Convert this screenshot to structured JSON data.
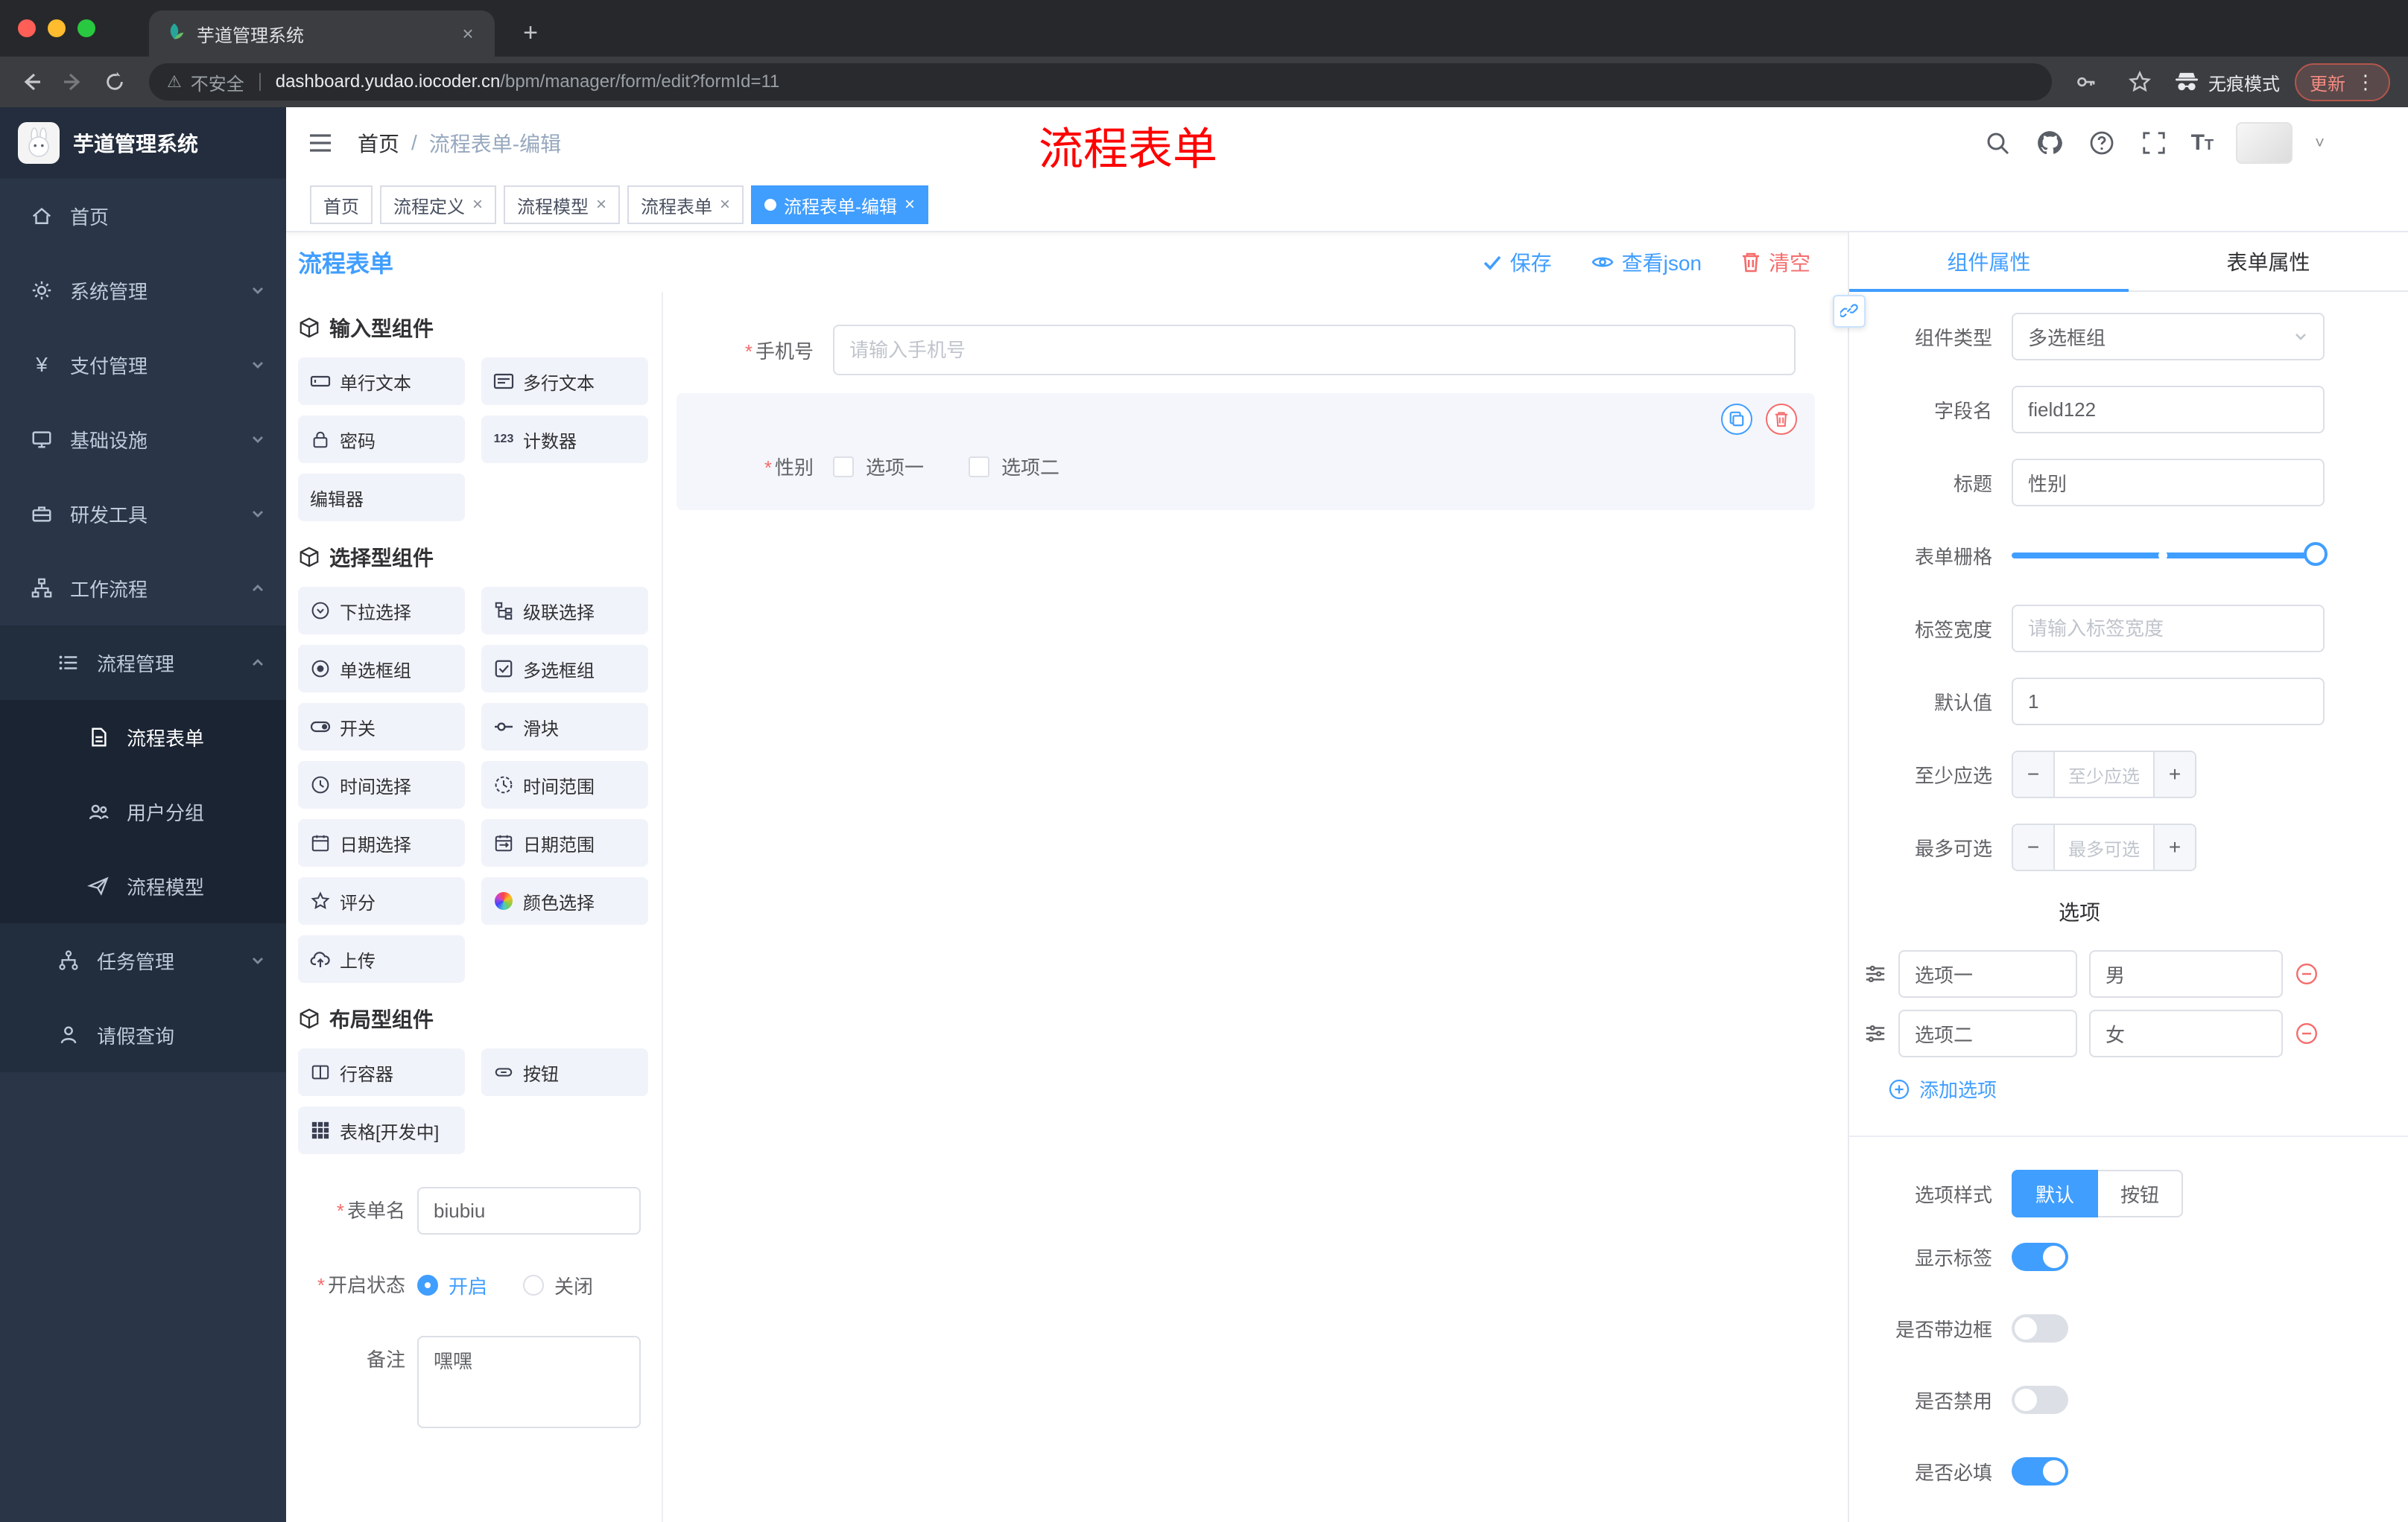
{
  "marks": {
    "required": "*",
    "close": "×",
    "plus": "+",
    "minus": "−",
    "kebab": "⋮",
    "warning": "⚠",
    "slash": "/",
    "caret": "˅",
    "dot123": "123",
    "font_big": "T",
    "font_small": "T",
    "yen": "¥"
  },
  "colors": {
    "primary": "#409eff",
    "danger": "#f56c6c",
    "annotation": "#fe0000",
    "sidebar_bg": "#2a3648"
  },
  "browser": {
    "tab_title": "芋道管理系统",
    "security_label": "不安全",
    "url_host": "dashboard.yudao.iocoder.cn",
    "url_path": "/bpm/manager/form/edit?formId=11",
    "incognito_label": "无痕模式",
    "update_label": "更新"
  },
  "sidebar": {
    "logo_title": "芋道管理系统",
    "home": "首页",
    "system": "系统管理",
    "payment": "支付管理",
    "infra": "基础设施",
    "devtools": "研发工具",
    "workflow": "工作流程",
    "process_mgmt": "流程管理",
    "process_form": "流程表单",
    "user_group": "用户分组",
    "process_model": "流程模型",
    "task_mgmt": "任务管理",
    "leave_query": "请假查询"
  },
  "header": {
    "breadcrumb_home": "首页",
    "breadcrumb_current": "流程表单-编辑",
    "annotation": "流程表单"
  },
  "tags": [
    {
      "label": "首页"
    },
    {
      "label": "流程定义"
    },
    {
      "label": "流程模型"
    },
    {
      "label": "流程表单"
    },
    {
      "label": "流程表单-编辑"
    }
  ],
  "designer": {
    "title": "流程表单",
    "save": "保存",
    "view_json": "查看json",
    "clear": "清空"
  },
  "palette": {
    "sections": [
      {
        "title": "输入型组件",
        "items": [
          {
            "label": "单行文本"
          },
          {
            "label": "多行文本"
          },
          {
            "label": "密码"
          },
          {
            "label": "计数器"
          },
          {
            "label": "编辑器"
          }
        ]
      },
      {
        "title": "选择型组件",
        "items": [
          {
            "label": "下拉选择"
          },
          {
            "label": "级联选择"
          },
          {
            "label": "单选框组"
          },
          {
            "label": "多选框组"
          },
          {
            "label": "开关"
          },
          {
            "label": "滑块"
          },
          {
            "label": "时间选择"
          },
          {
            "label": "时间范围"
          },
          {
            "label": "日期选择"
          },
          {
            "label": "日期范围"
          },
          {
            "label": "评分"
          },
          {
            "label": "颜色选择"
          },
          {
            "label": "上传"
          }
        ]
      },
      {
        "title": "布局型组件",
        "items": [
          {
            "label": "行容器"
          },
          {
            "label": "按钮"
          },
          {
            "label": "表格[开发中]"
          }
        ]
      }
    ]
  },
  "form_settings": {
    "name_label": "表单名",
    "name_value": "biubiu",
    "status_label": "开启状态",
    "status_on": "开启",
    "status_off": "关闭",
    "remark_label": "备注",
    "remark_value": "嘿嘿"
  },
  "canvas": {
    "phone_label": "手机号",
    "phone_placeholder": "请输入手机号",
    "gender_label": "性别",
    "gender_option1": "选项一",
    "gender_option2": "选项二"
  },
  "props": {
    "tab_component": "组件属性",
    "tab_form": "表单属性",
    "component_type_label": "组件类型",
    "component_type_value": "多选框组",
    "field_name_label": "字段名",
    "field_name_value": "field122",
    "title_label": "标题",
    "title_value": "性别",
    "grid_label": "表单栅格",
    "label_width_label": "标签宽度",
    "label_width_placeholder": "请输入标签宽度",
    "default_label": "默认值",
    "default_value": "1",
    "min_label": "至少应选",
    "min_placeholder": "至少应选",
    "max_label": "最多可选",
    "max_placeholder": "最多可选",
    "options_title": "选项",
    "options": [
      {
        "name": "选项一",
        "value": "男"
      },
      {
        "name": "选项二",
        "value": "女"
      }
    ],
    "add_option": "添加选项",
    "style_label": "选项样式",
    "style_default": "默认",
    "style_button": "按钮",
    "show_label": "显示标签",
    "border_label": "是否带边框",
    "disabled_label": "是否禁用",
    "required_label": "是否必填"
  }
}
